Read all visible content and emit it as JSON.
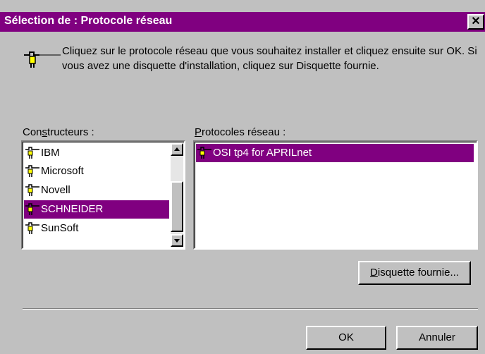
{
  "dialog": {
    "title": "Sélection de : Protocole réseau",
    "close_glyph": "✕",
    "description": "Cliquez sur le protocole réseau que vous souhaitez installer et cliquez ensuite sur OK. Si vous avez une disquette d'installation, cliquez sur Disquette fournie.",
    "header_icon": "network-plug-icon"
  },
  "manufacturers": {
    "label_before": "Con",
    "label_mnemonic": "s",
    "label_after": "tructeurs :",
    "items": [
      "IBM",
      "Microsoft",
      "Novell",
      "SCHNEIDER",
      "SunSoft"
    ],
    "selected": "SCHNEIDER",
    "item_icon": "network-plug-icon"
  },
  "protocols": {
    "label_before": "",
    "label_mnemonic": "P",
    "label_after": "rotocoles réseau :",
    "items": [
      "OSI tp4 for APRILnet"
    ],
    "selected": "OSI tp4 for APRILnet",
    "item_icon": "network-plug-icon"
  },
  "buttons": {
    "have_disk_mnemonic": "D",
    "have_disk_rest": "isquette fournie...",
    "ok": "OK",
    "cancel": "Annuler"
  },
  "colors": {
    "title_bar": "#800080",
    "selection": "#800080",
    "face": "#c0c0c0"
  }
}
